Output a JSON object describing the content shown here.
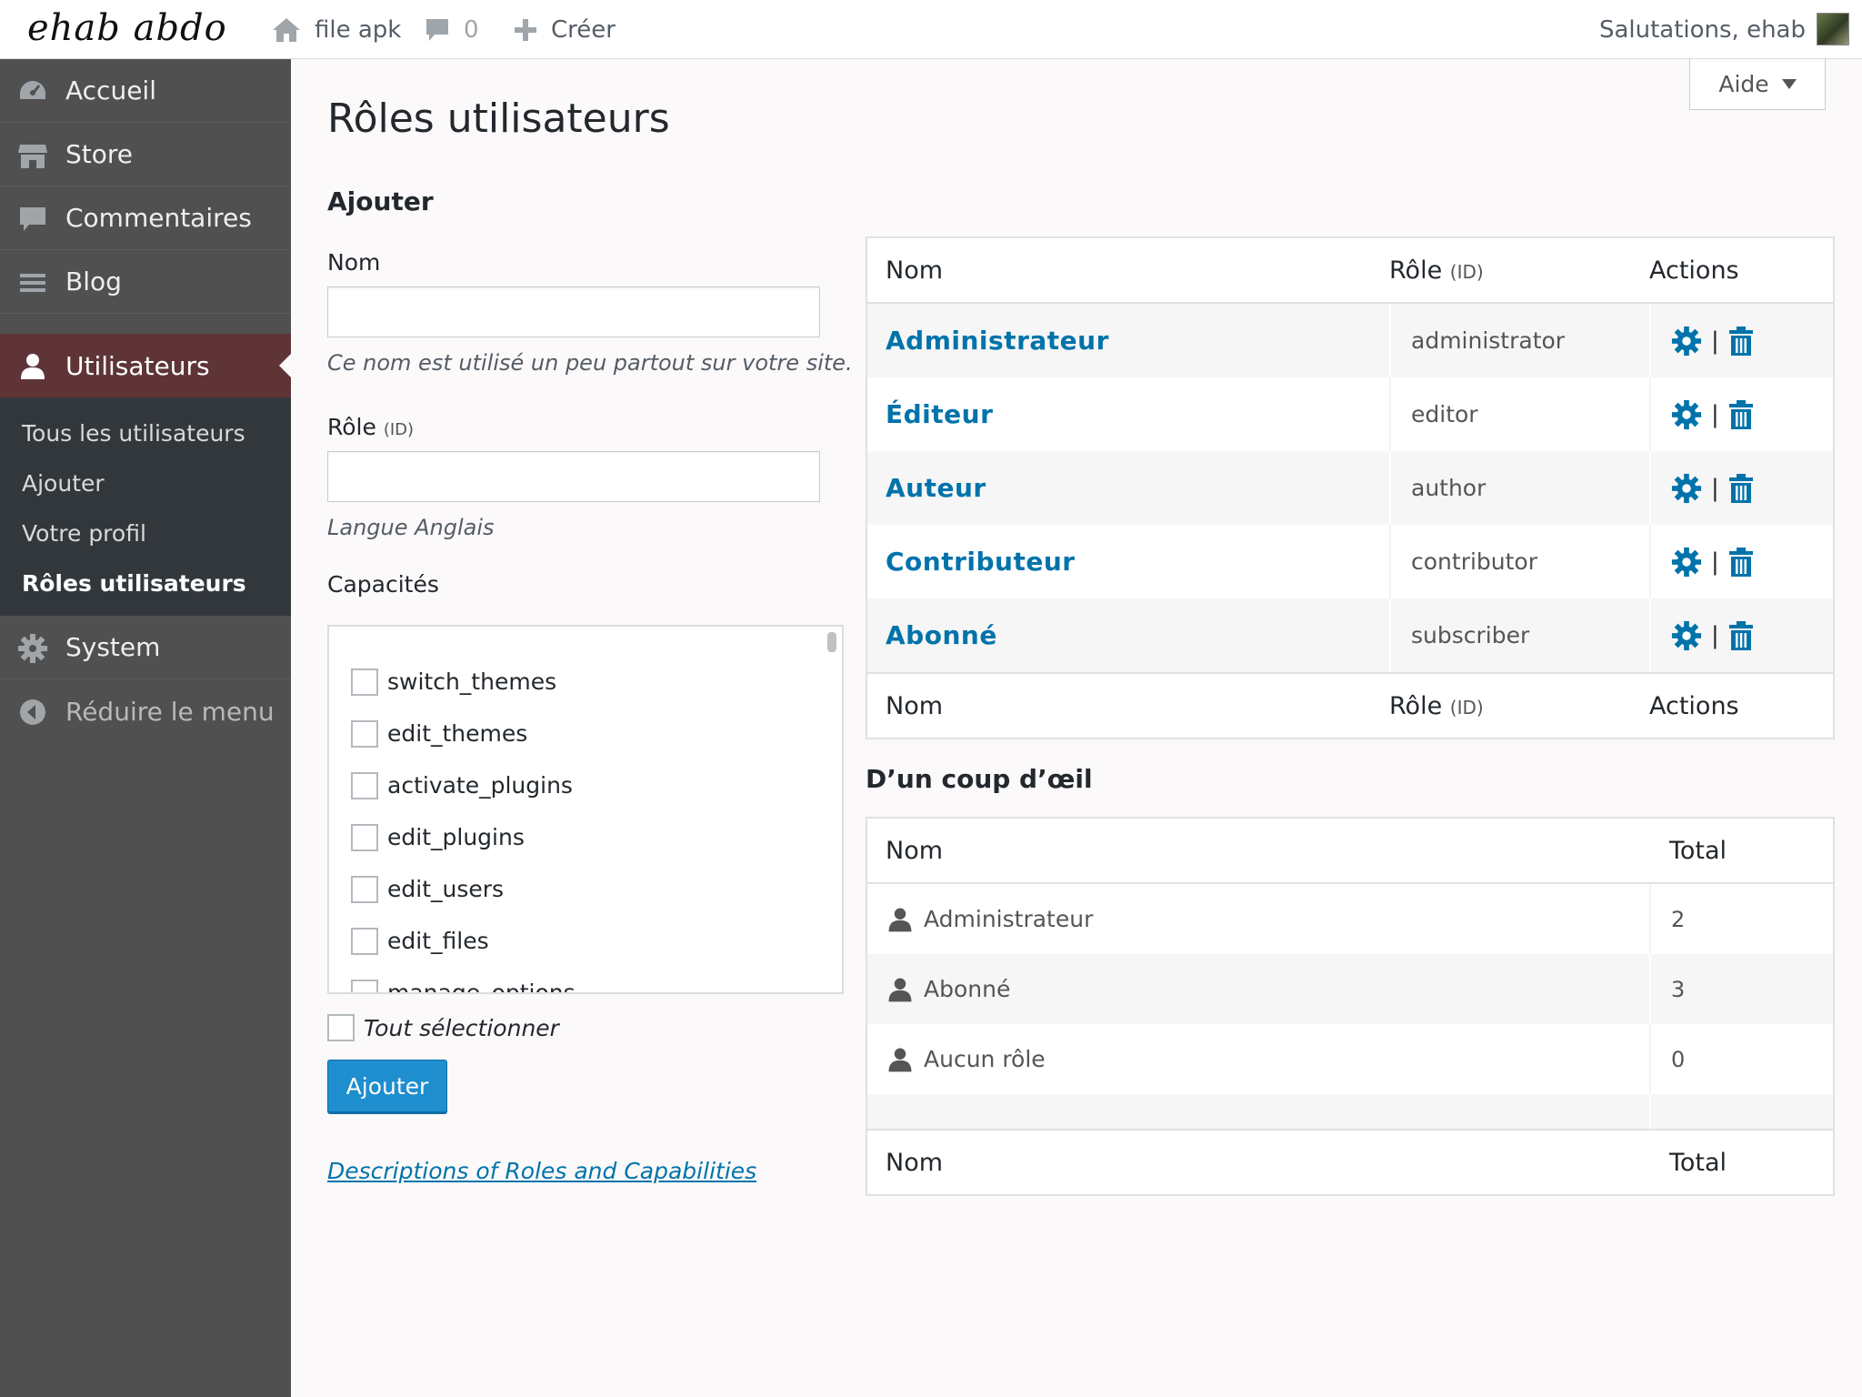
{
  "topbar": {
    "site_name": "ehab abdo",
    "site_link": "file apk",
    "comments_count": "0",
    "new_label": "Créer",
    "greeting": "Salutations, ehab"
  },
  "sidebar": {
    "items": [
      {
        "label": "Accueil",
        "icon": "dashboard-icon"
      },
      {
        "label": "Store",
        "icon": "store-icon"
      },
      {
        "label": "Commentaires",
        "icon": "comment-icon"
      },
      {
        "label": "Blog",
        "icon": "list-icon"
      }
    ],
    "active": {
      "label": "Utilisateurs",
      "icon": "user-icon"
    },
    "submenu": [
      "Tous les utilisateurs",
      "Ajouter",
      "Votre profil",
      "Rôles utilisateurs"
    ],
    "system": "System",
    "collapse": "Réduire le menu"
  },
  "help": "Aide",
  "page_title": "Rôles utilisateurs",
  "form": {
    "heading": "Ajouter",
    "name_label": "Nom",
    "name_value": "",
    "name_desc": "Ce nom est utilisé un peu partout sur votre site.",
    "role_label": "Rôle",
    "role_id": "(ID)",
    "role_value": "",
    "role_desc": "Langue Anglais",
    "caps_label": "Capacités",
    "capabilities": [
      "switch_themes",
      "edit_themes",
      "activate_plugins",
      "edit_plugins",
      "edit_users",
      "edit_files",
      "manage_options"
    ],
    "select_all": "Tout sélectionner",
    "submit": "Ajouter",
    "doc_link": "Descriptions of Roles and Capabilities"
  },
  "roles_table": {
    "col_name": "Nom",
    "col_role": "Rôle",
    "col_role_id": "(ID)",
    "col_actions": "Actions",
    "separator": "|",
    "rows": [
      {
        "name": "Administrateur",
        "id": "administrator"
      },
      {
        "name": "Éditeur",
        "id": "editor"
      },
      {
        "name": "Auteur",
        "id": "author"
      },
      {
        "name": "Contributeur",
        "id": "contributor"
      },
      {
        "name": "Abonné",
        "id": "subscriber"
      }
    ]
  },
  "glance": {
    "heading": "D’un coup d’œil",
    "col_name": "Nom",
    "col_total": "Total",
    "rows": [
      {
        "name": "Administrateur",
        "total": "2"
      },
      {
        "name": "Abonné",
        "total": "3"
      },
      {
        "name": "Aucun rôle",
        "total": "0"
      }
    ]
  },
  "colors": {
    "link": "#0073aa",
    "sidebar": "#505050",
    "active_menu": "#5e3437",
    "submenu": "#32373c",
    "button": "#1e8ecf"
  }
}
